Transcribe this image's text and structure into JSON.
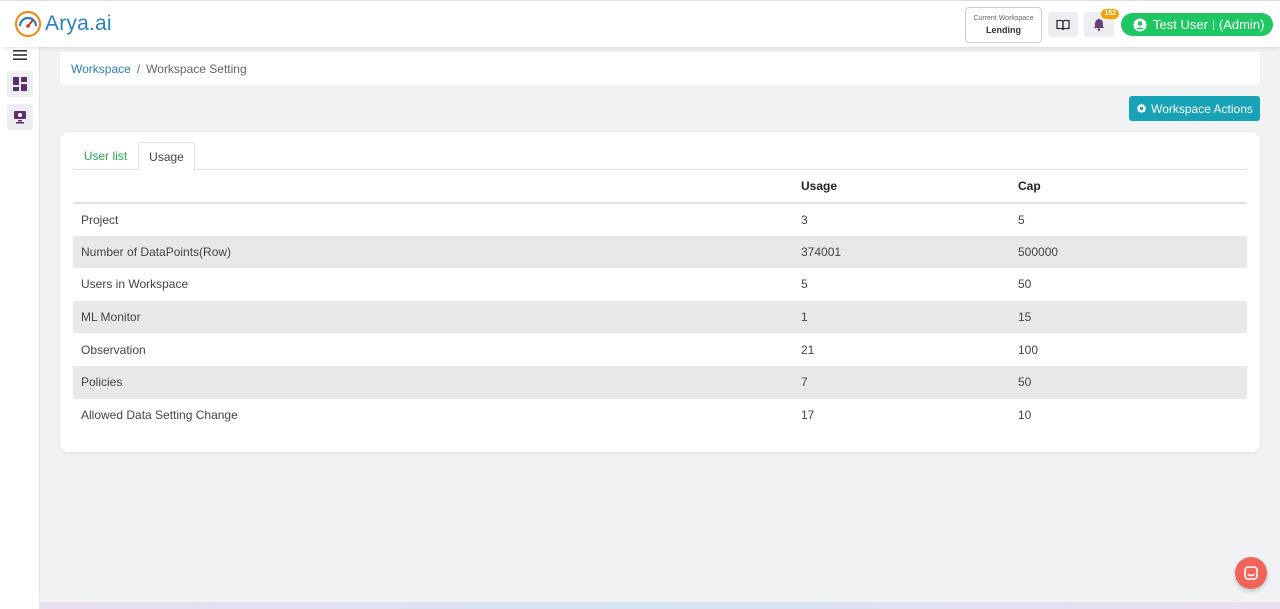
{
  "header": {
    "brand": "Arya.ai",
    "workspace_label": "Current Workspace",
    "workspace_name": "Lending",
    "notification_count": "152",
    "user_name": "Test User",
    "user_role": "(Admin)"
  },
  "breadcrumb": {
    "parent": "Workspace",
    "separator": "/",
    "current": "Workspace Setting"
  },
  "actions": {
    "workspace_actions_label": "Workspace Actions"
  },
  "tabs": [
    {
      "label": "User list",
      "active": false
    },
    {
      "label": "Usage",
      "active": true
    }
  ],
  "usage_table": {
    "columns": [
      "",
      "Usage",
      "Cap"
    ],
    "rows": [
      {
        "name": "Project",
        "usage": "3",
        "cap": "5"
      },
      {
        "name": "Number of DataPoints(Row)",
        "usage": "374001",
        "cap": "500000"
      },
      {
        "name": "Users in Workspace",
        "usage": "5",
        "cap": "50"
      },
      {
        "name": "ML Monitor",
        "usage": "1",
        "cap": "15"
      },
      {
        "name": "Observation",
        "usage": "21",
        "cap": "100"
      },
      {
        "name": "Policies",
        "usage": "7",
        "cap": "50"
      },
      {
        "name": "Allowed Data Setting Change",
        "usage": "17",
        "cap": "10"
      }
    ]
  },
  "colors": {
    "accent_blue": "#2a7fc1",
    "user_green": "#1fc763",
    "action_teal": "#17a2b8",
    "tab_green": "#28a745",
    "badge_orange": "#f4a300",
    "chat_red": "#f0645a"
  },
  "icons": {
    "logo": "arya-logo-icon",
    "menu": "hamburger-menu-icon",
    "dashboard": "dashboard-icon",
    "monitor": "model-monitor-icon",
    "docs": "book-icon",
    "notifications": "bell-icon",
    "user": "user-circle-icon",
    "settings": "gear-icon",
    "chat": "chat-icon"
  }
}
